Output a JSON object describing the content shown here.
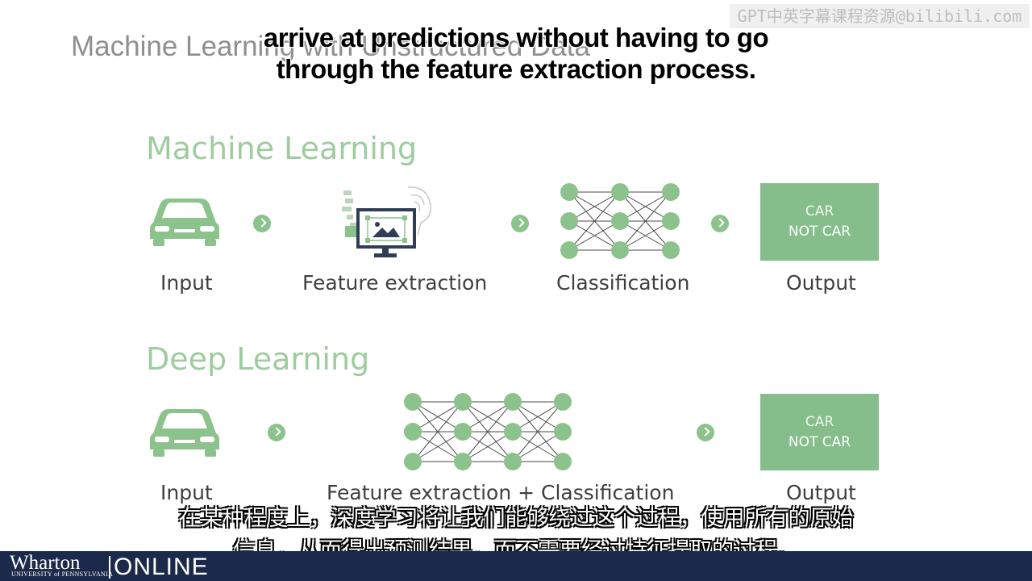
{
  "slide": {
    "title": "Machine Learning with Unstructured Data"
  },
  "watermark": "GPT中英字幕课程资源@bilibili.com",
  "subtitle_en": {
    "line1": "arrive at predictions without having to go",
    "line2": "through the feature extraction process."
  },
  "subtitle_zh": {
    "line1": "在某种程度上，深度学习将让我们能够绕过这个过程，使用所有的原始",
    "line2": "信息，从而得出预测结果，而不需要经过特征提取的过程。"
  },
  "machine_learning": {
    "title": "Machine Learning",
    "steps": [
      "Input",
      "Feature extraction",
      "Classification",
      "Output"
    ],
    "output_box": {
      "line1": "CAR",
      "line2": "NOT CAR"
    }
  },
  "deep_learning": {
    "title": "Deep Learning",
    "steps": [
      "Input",
      "Feature extraction + Classification",
      "Output"
    ],
    "output_box": {
      "line1": "CAR",
      "line2": "NOT CAR"
    }
  },
  "footer": {
    "brand": "Wharton",
    "university": "UNIVERSITY of PENNSYLVANIA",
    "online": "ONLINE"
  },
  "colors": {
    "accent_green": "#85be8b",
    "title_green": "#9fcc9f",
    "footer_navy": "#1b2a4a"
  },
  "icons": [
    "car-icon",
    "feature-extraction-icon",
    "neural-network-icon",
    "chevron-right-icon"
  ]
}
